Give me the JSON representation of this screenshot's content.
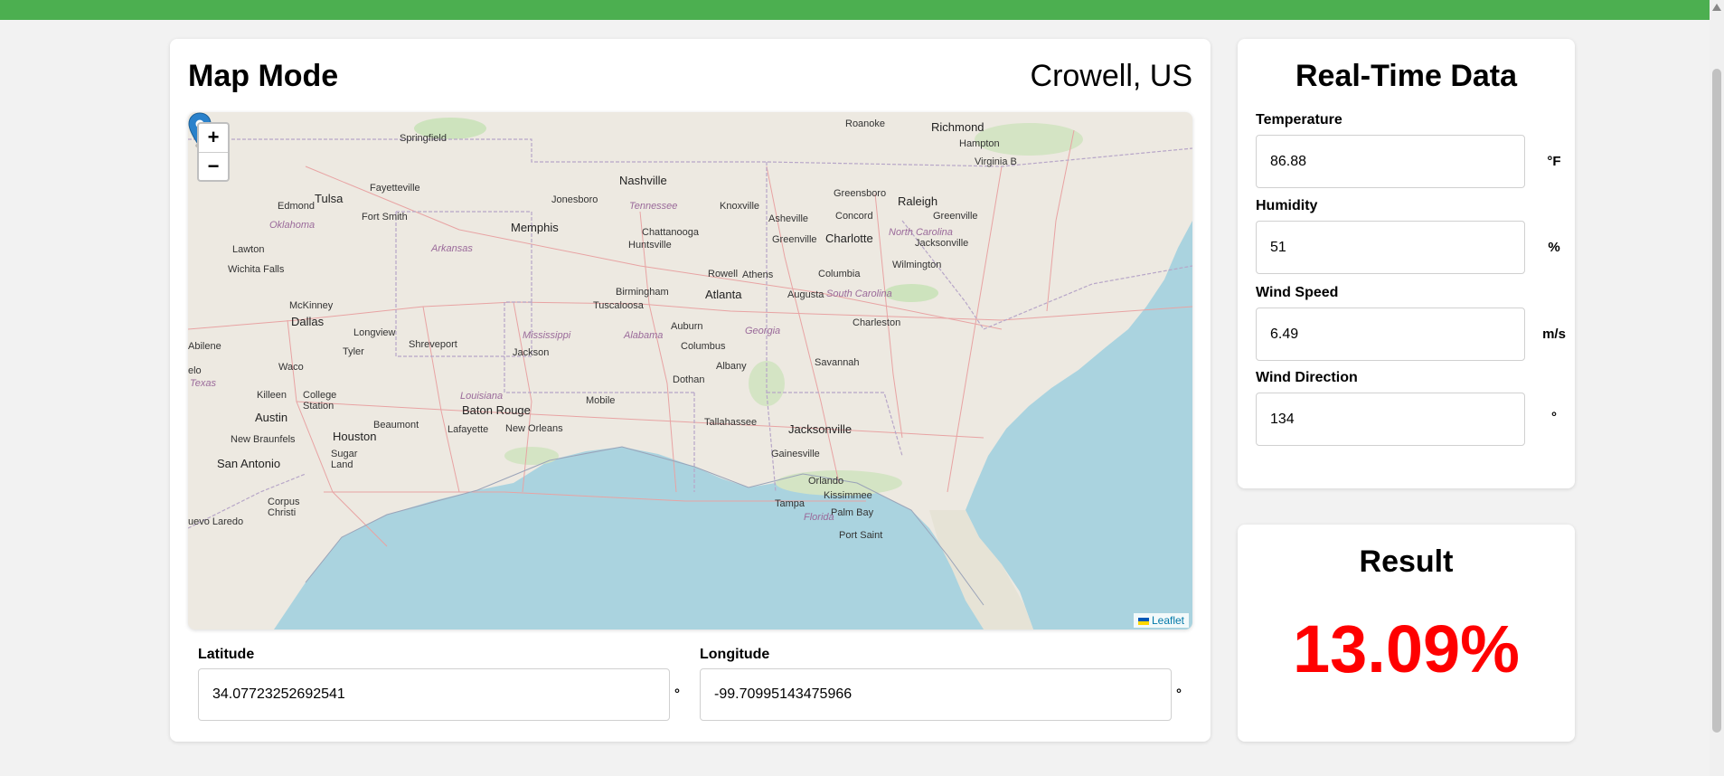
{
  "map_panel": {
    "title": "Map Mode",
    "location": "Crowell, US",
    "zoom_in": "+",
    "zoom_out": "−",
    "attribution": "Leaflet",
    "labels": {
      "springfield": "Springfield",
      "nashville": "Nashville",
      "roanoke": "Roanoke",
      "richmond": "Richmond",
      "hampton": "Hampton",
      "virginia_beach": "Virginia B",
      "tulsa": "Tulsa",
      "edmond": "Edmond",
      "oklahoma": "Oklahoma",
      "fayetteville": "Fayetteville",
      "jonesboro": "Jonesboro",
      "tennessee": "Tennessee",
      "knoxville": "Knoxville",
      "greensboro": "Greensboro",
      "raleigh": "Raleigh",
      "fort_smith": "Fort Smith",
      "memphis": "Memphis",
      "chattanooga": "Chattanooga",
      "asheville": "Asheville",
      "concord": "Concord",
      "greenville_nc": "Greenville",
      "north_carolina": "North Carolina",
      "lawton": "Lawton",
      "arkansas": "Arkansas",
      "huntsville": "Huntsville",
      "greenville_sc": "Greenville",
      "charlotte": "Charlotte",
      "jacksonville_nc": "Jacksonville",
      "wichita_falls": "Wichita Falls",
      "rowell": "Rowell",
      "athens": "Athens",
      "columbia": "Columbia",
      "wilmington": "Wilmington",
      "birmingham": "Birmingham",
      "atlanta": "Atlanta",
      "augusta": "Augusta",
      "south_carolina": "South Carolina",
      "mckinney": "McKinney",
      "tuscaloosa": "Tuscaloosa",
      "dallas": "Dallas",
      "longview": "Longview",
      "charleston": "Charleston",
      "auburn": "Auburn",
      "georgia": "Georgia",
      "mississippi": "Mississippi",
      "alabama": "Alabama",
      "shreveport": "Shreveport",
      "abilene": "Abilene",
      "tyler": "Tyler",
      "columbus": "Columbus",
      "jackson": "Jackson",
      "savannah": "Savannah",
      "waco": "Waco",
      "albany": "Albany",
      "elo": "elo",
      "texas": "Texas",
      "dothan": "Dothan",
      "killeen": "Killeen",
      "college_station": "College Station",
      "louisiana": "Louisiana",
      "mobile": "Mobile",
      "baton_rouge": "Baton Rouge",
      "austin": "Austin",
      "beaumont": "Beaumont",
      "tallahassee": "Tallahassee",
      "jacksonville_fl": "Jacksonville",
      "lafayette": "Lafayette",
      "new_orleans": "New Orleans",
      "new_braunfels": "New Braunfels",
      "houston": "Houston",
      "gainesville": "Gainesville",
      "sugar_land": "Sugar Land",
      "san_antonio": "San Antonio",
      "orlando": "Orlando",
      "kissimmee": "Kissimmee",
      "corpus_christi": "Corpus Christi",
      "tampa": "Tampa",
      "palm_bay": "Palm Bay",
      "florida": "Florida",
      "nuevo_laredo": "uevo Laredo",
      "port_saint": "Port Saint"
    }
  },
  "latitude": {
    "label": "Latitude",
    "value": "34.07723252692541",
    "unit": "°"
  },
  "longitude": {
    "label": "Longitude",
    "value": "-99.70995143475966",
    "unit": "°"
  },
  "realtime": {
    "title": "Real-Time Data",
    "temperature": {
      "label": "Temperature",
      "value": "86.88",
      "unit": "°F"
    },
    "humidity": {
      "label": "Humidity",
      "value": "51",
      "unit": "%"
    },
    "wind_speed": {
      "label": "Wind Speed",
      "value": "6.49",
      "unit": "m/s"
    },
    "wind_direction": {
      "label": "Wind Direction",
      "value": "134",
      "unit": "°"
    }
  },
  "result": {
    "title": "Result",
    "value": "13.09%"
  },
  "colors": {
    "topbar": "#4caf50",
    "result_value": "#ff0000",
    "marker": "#2a81cb",
    "water": "#aad3df",
    "land": "#ede9e1",
    "link": "#0078a8"
  }
}
